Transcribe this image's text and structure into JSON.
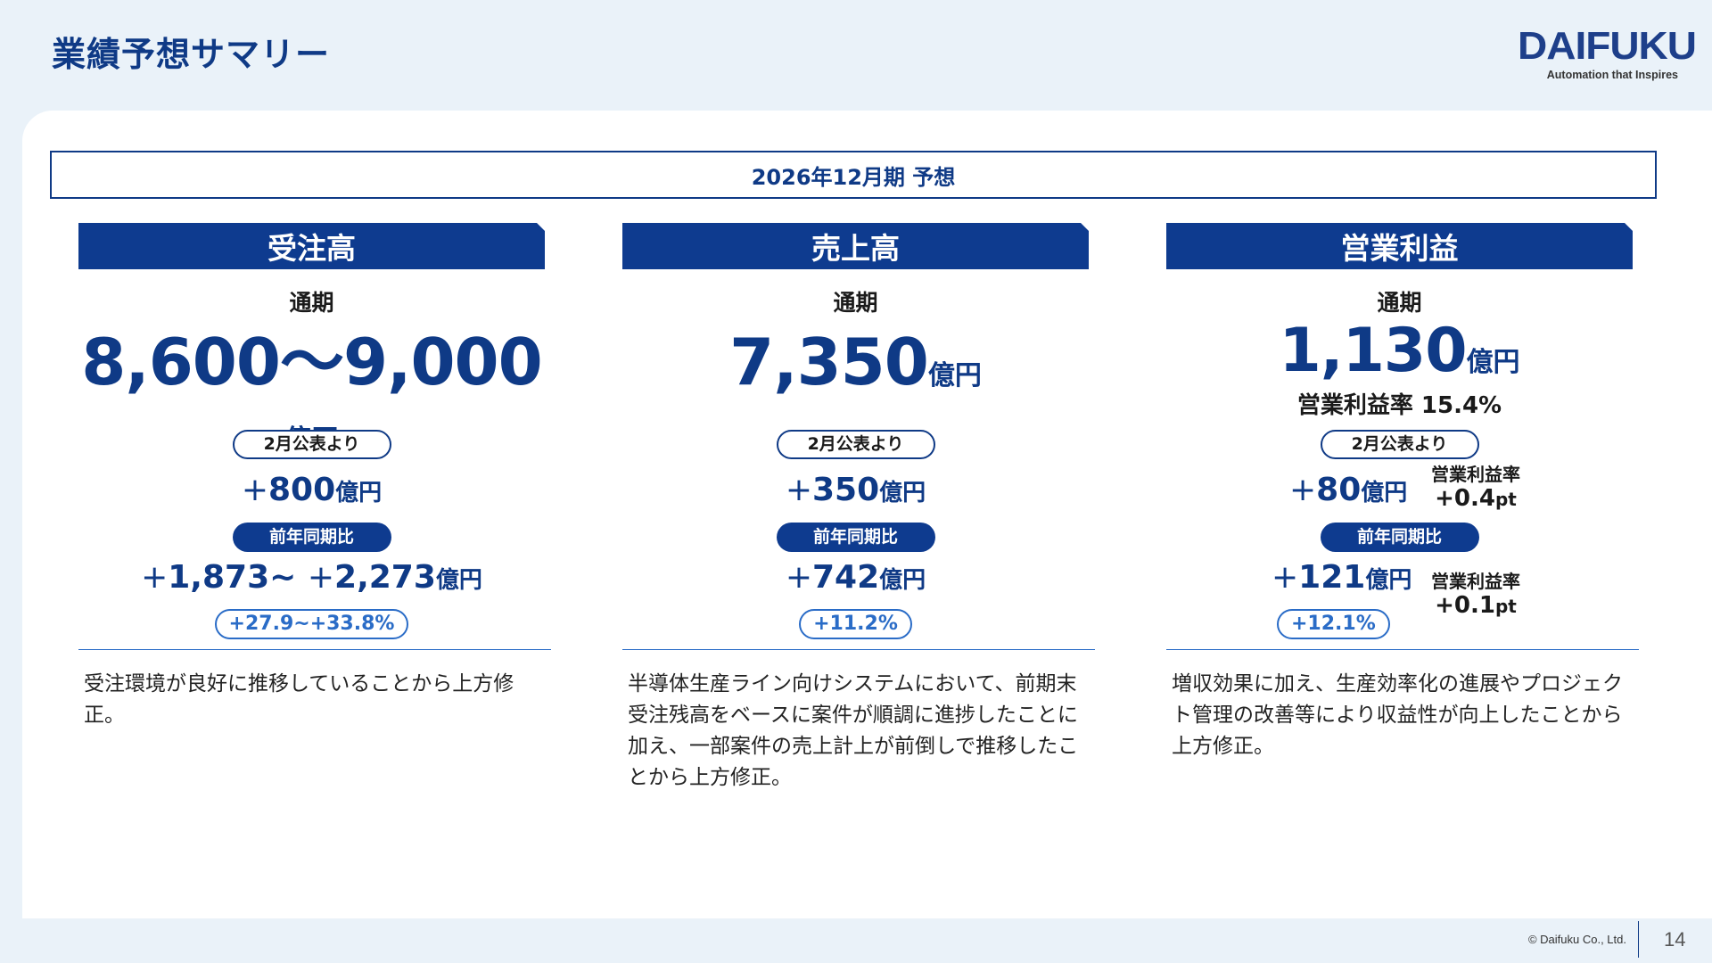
{
  "header": {
    "title": "業績予想サマリー",
    "logo_text": "DAIFUKU",
    "logo_tagline": "Automation that Inspires"
  },
  "period_label": "2026年12月期 予想",
  "columns": [
    {
      "header": "受注高",
      "term_label": "通期",
      "value": "8,600～9,000",
      "unit": "億円",
      "vs_plan_label": "2月公表より",
      "vs_plan_delta": "800",
      "yoy_label": "前年同期比",
      "yoy_delta_from": "1,873",
      "yoy_delta_to": "2,273",
      "yoy_pct": "+27.9~+33.8%",
      "description": "受注環境が良好に推移していることから上方修正。"
    },
    {
      "header": "売上高",
      "term_label": "通期",
      "value": "7,350",
      "unit": "億円",
      "vs_plan_label": "2月公表より",
      "vs_plan_delta": "350",
      "yoy_label": "前年同期比",
      "yoy_delta": "742",
      "yoy_pct": "+11.2%",
      "description": "半導体生産ライン向けシステムにおいて、前期末受注残高をベースに案件が順調に進捗したことに加え、一部案件の売上計上が前倒しで推移したことから上方修正。"
    },
    {
      "header": "営業利益",
      "term_label": "通期",
      "value": "1,130",
      "unit": "億円",
      "margin_text": "営業利益率 15.4%",
      "vs_plan_label": "2月公表より",
      "vs_plan_delta": "80",
      "vs_plan_margin_label": "営業利益率",
      "vs_plan_margin_delta": "0.4",
      "yoy_label": "前年同期比",
      "yoy_delta": "121",
      "yoy_pct": "+12.1%",
      "yoy_margin_label": "営業利益率",
      "yoy_margin_delta": "0.1",
      "description": "増収効果に加え、生産効率化の進展やプロジェクト管理の改善等により収益性が向上したことから上方修正。"
    }
  ],
  "common": {
    "plus": "+",
    "tilde": "~",
    "pt": "pt"
  },
  "footer": {
    "copyright": "© Daifuku Co., Ltd.",
    "page_number": "14"
  }
}
